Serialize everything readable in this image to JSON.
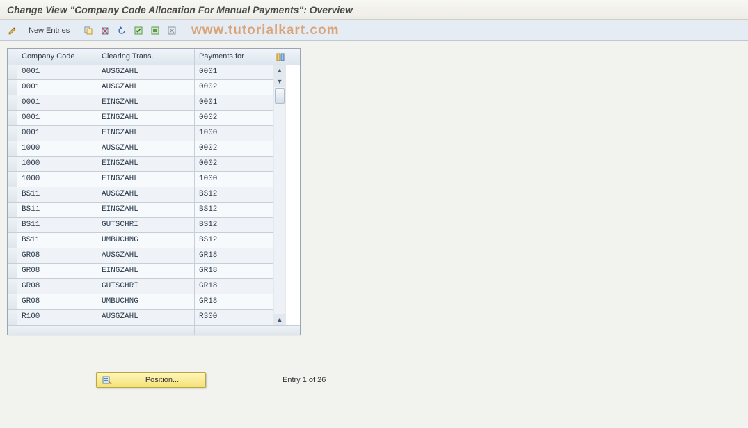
{
  "title": "Change View \"Company Code Allocation For Manual Payments\": Overview",
  "watermark": "www.tutorialkart.com",
  "toolbar": {
    "new_entries_label": "New Entries"
  },
  "table": {
    "headers": {
      "company_code": "Company Code",
      "clearing_trans": "Clearing Trans.",
      "payments_for": "Payments for"
    },
    "rows": [
      {
        "cc": "0001",
        "ct": "AUSGZAHL",
        "pf": "0001"
      },
      {
        "cc": "0001",
        "ct": "AUSGZAHL",
        "pf": "0002"
      },
      {
        "cc": "0001",
        "ct": "EINGZAHL",
        "pf": "0001"
      },
      {
        "cc": "0001",
        "ct": "EINGZAHL",
        "pf": "0002"
      },
      {
        "cc": "0001",
        "ct": "EINGZAHL",
        "pf": "1000"
      },
      {
        "cc": "1000",
        "ct": "AUSGZAHL",
        "pf": "0002"
      },
      {
        "cc": "1000",
        "ct": "EINGZAHL",
        "pf": "0002"
      },
      {
        "cc": "1000",
        "ct": "EINGZAHL",
        "pf": "1000"
      },
      {
        "cc": "BS11",
        "ct": "AUSGZAHL",
        "pf": "BS12"
      },
      {
        "cc": "BS11",
        "ct": "EINGZAHL",
        "pf": "BS12"
      },
      {
        "cc": "BS11",
        "ct": "GUTSCHRI",
        "pf": "BS12"
      },
      {
        "cc": "BS11",
        "ct": "UMBUCHNG",
        "pf": "BS12"
      },
      {
        "cc": "GR08",
        "ct": "AUSGZAHL",
        "pf": "GR18"
      },
      {
        "cc": "GR08",
        "ct": "EINGZAHL",
        "pf": "GR18"
      },
      {
        "cc": "GR08",
        "ct": "GUTSCHRI",
        "pf": "GR18"
      },
      {
        "cc": "GR08",
        "ct": "UMBUCHNG",
        "pf": "GR18"
      },
      {
        "cc": "R100",
        "ct": "AUSGZAHL",
        "pf": "R300"
      }
    ]
  },
  "footer": {
    "position_label": "Position...",
    "entry_status": "Entry 1 of 26"
  }
}
